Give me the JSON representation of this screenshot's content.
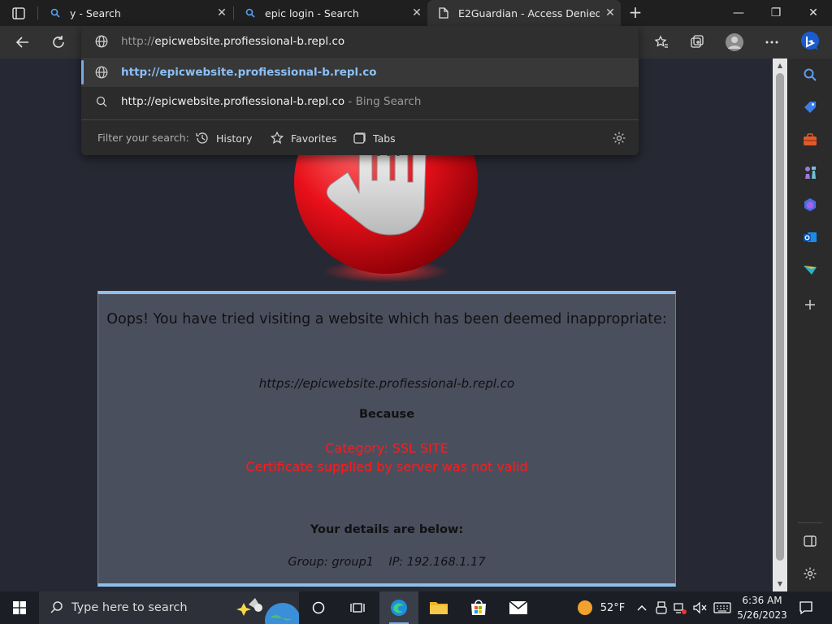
{
  "browser": {
    "tabs": [
      {
        "title": "y - Search",
        "type": "search"
      },
      {
        "title": "epic login - Search",
        "type": "search"
      },
      {
        "title": "E2Guardian - Access Denied",
        "type": "page"
      }
    ],
    "close_glyph": "✕",
    "new_tab_glyph": "+",
    "window_controls": {
      "minimize": "—",
      "restore": "❐",
      "close": "✕"
    }
  },
  "omnibox": {
    "input_prefix": "http://",
    "input_rest": "epicwebsite.profiessional-b.repl.co",
    "suggestions": [
      {
        "text": "http://epicwebsite.profiessional-b.repl.co",
        "icon": "globe-icon"
      },
      {
        "text": "http://epicwebsite.profiessional-b.repl.co",
        "suffix": " - Bing Search",
        "icon": "search-icon"
      }
    ],
    "filter_label": "Filter your search:",
    "filters": [
      "History",
      "Favorites",
      "Tabs"
    ]
  },
  "page": {
    "heading": "Oops! You have tried visiting a website which has been deemed inappropriate:",
    "url": "https://epicwebsite.profiessional-b.repl.co",
    "because": "Because",
    "category": "Category: SSL SITE",
    "reason": "Certificate supplied by server was not valid",
    "details_heading": "Your details are below:",
    "group_line": "Group: group1    IP: 192.168.1.17"
  },
  "taskbar": {
    "search_placeholder": "Type here to search",
    "weather": "52°F",
    "time": "6:36 AM",
    "date": "5/26/2023"
  },
  "colors": {
    "accent": "#7aa9e6",
    "alert_red": "#ff1b1b",
    "panel_border": "#8fbfe8"
  }
}
